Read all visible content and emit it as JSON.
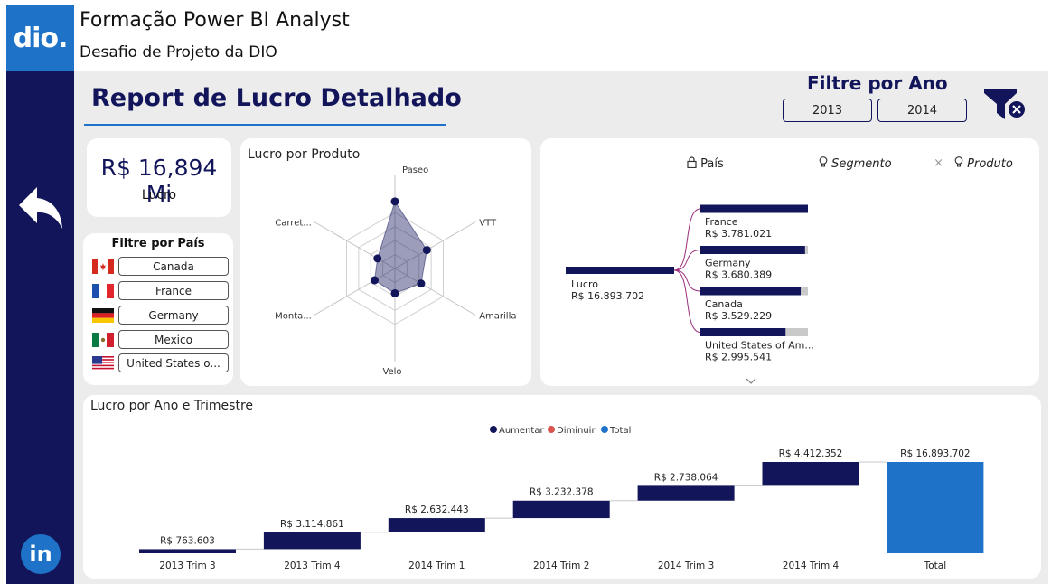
{
  "header": {
    "logo": "dio.",
    "title": "Formação Power BI Analyst",
    "subtitle": "Desafio de Projeto da DIO"
  },
  "sidebar": {
    "back_icon": "back-arrow-icon",
    "linkedin_icon": "linkedin-icon",
    "linkedin_text": "in"
  },
  "report": {
    "title": "Report de Lucro Detalhado"
  },
  "year_filter": {
    "label": "Filtre por Ano",
    "years": [
      "2013",
      "2014"
    ],
    "clear_icon": "clear-filter-icon"
  },
  "kpi": {
    "value": "R$ 16,894 Mi",
    "label": "Lucro"
  },
  "country_filter": {
    "title": "Filtre por País",
    "countries": [
      {
        "label": "Canada",
        "flag": "canada-flag"
      },
      {
        "label": "France",
        "flag": "france-flag"
      },
      {
        "label": "Germany",
        "flag": "germany-flag"
      },
      {
        "label": "Mexico",
        "flag": "mexico-flag"
      },
      {
        "label": "United States o...",
        "flag": "usa-flag"
      }
    ]
  },
  "colors": {
    "navy": "#12155a",
    "blue": "#1e73c8",
    "red": "#d9534f",
    "canvas": "#ececec"
  },
  "tree": {
    "fields": [
      {
        "label": "País",
        "icon": "lock-icon"
      },
      {
        "label": "Segmento",
        "icon": "lightbulb-icon"
      },
      {
        "label": "Produto",
        "icon": "lightbulb-icon"
      }
    ],
    "root": {
      "label": "Lucro",
      "value": "R$ 16.893.702",
      "fraction": 1.0
    },
    "children": [
      {
        "label": "France",
        "value": "R$ 3.781.021",
        "fraction": 1.0
      },
      {
        "label": "Germany",
        "value": "R$ 3.680.389",
        "fraction": 0.973
      },
      {
        "label": "Canada",
        "value": "R$ 3.529.229",
        "fraction": 0.933
      },
      {
        "label": "United States of Am...",
        "value": "R$ 2.995.541",
        "fraction": 0.792
      }
    ]
  },
  "chart_data": [
    {
      "type": "radar",
      "title": "Lucro por Produto",
      "categories": [
        "Paseo",
        "VTT",
        "Amarilla",
        "Velo",
        "Monta...",
        "Carret..."
      ],
      "values": [
        1.0,
        0.55,
        0.45,
        0.37,
        0.35,
        0.3
      ]
    },
    {
      "type": "waterfall",
      "title": "Lucro por Ano e Trimestre",
      "legend": [
        "Aumentar",
        "Diminuir",
        "Total"
      ],
      "categories": [
        "2013 Trim 3",
        "2013 Trim 4",
        "2014 Trim 1",
        "2014 Trim 2",
        "2014 Trim 3",
        "2014 Trim 4",
        "Total"
      ],
      "values": [
        763603,
        3114861,
        2632443,
        3232378,
        2738064,
        4412352,
        16893702
      ],
      "labels": [
        "R$ 763.603",
        "R$ 3.114.861",
        "R$ 2.632.443",
        "R$ 3.232.378",
        "R$ 2.738.064",
        "R$ 4.412.352",
        "R$ 16.893.702"
      ],
      "ylim": [
        0,
        17500000
      ]
    }
  ]
}
